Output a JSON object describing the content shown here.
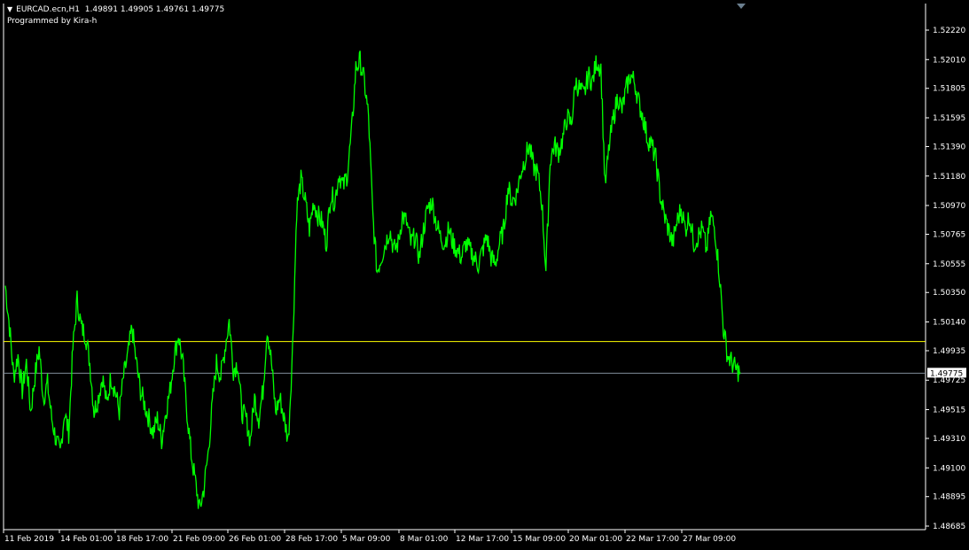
{
  "header": {
    "symbol": "EURCAD.ecn,H1",
    "ohlc": "1.49891 1.49905 1.49761 1.49775",
    "indicator": "Programmed by Kira-h"
  },
  "colors": {
    "background": "#000000",
    "axis": "#ffffff",
    "price_line": "#00ff00",
    "horizontal_line": "#ffff00",
    "bid_line": "#7f8c99",
    "bid_label_bg": "#ffffff",
    "bid_label_text": "#000000"
  },
  "chart_data": {
    "type": "line",
    "title": "",
    "xlabel": "",
    "ylabel": "",
    "ylim": [
      1.4858,
      1.5232
    ],
    "x_tick_labels": [
      "11 Feb 2019",
      "14 Feb 01:00",
      "18 Feb 17:00",
      "21 Feb 09:00",
      "26 Feb 01:00",
      "28 Feb 17:00",
      "5 Mar 09:00",
      "8 Mar 01:00",
      "12 Mar 17:00",
      "15 Mar 09:00",
      "20 Mar 01:00",
      "22 Mar 17:00",
      "27 Mar 09:00"
    ],
    "y_ticks": [
      "1.52220",
      "1.52010",
      "1.51805",
      "1.51595",
      "1.51390",
      "1.51180",
      "1.50970",
      "1.50765",
      "1.50555",
      "1.50350",
      "1.50140",
      "1.49935",
      "1.49725",
      "1.49515",
      "1.49310",
      "1.49100",
      "1.48895",
      "1.48685"
    ],
    "horizontal_level": 1.5,
    "current_price": "1.49775",
    "series": [
      {
        "values": [
          1.504,
          1.501,
          1.4975,
          1.499,
          1.4965,
          1.4985,
          1.495,
          1.4975,
          1.4995,
          1.496,
          1.497,
          1.4945,
          1.493,
          1.492,
          1.495,
          1.4935,
          1.4995,
          1.503,
          1.501,
          1.5005,
          1.4985,
          1.495,
          1.496,
          1.4975,
          1.4955,
          1.4975,
          1.4965,
          1.495,
          1.4975,
          1.499,
          1.501,
          1.4985,
          1.4965,
          1.4955,
          1.4945,
          1.4935,
          1.4945,
          1.493,
          1.495,
          1.4965,
          1.499,
          1.5005,
          1.4985,
          1.495,
          1.492,
          1.49,
          1.488,
          1.4895,
          1.492,
          1.4955,
          1.4985,
          1.4975,
          1.4995,
          1.5015,
          1.498,
          1.4985,
          1.495,
          1.4945,
          1.493,
          1.496,
          1.4945,
          1.4965,
          1.501,
          1.4985,
          1.495,
          1.496,
          1.4945,
          1.493,
          1.4995,
          1.5095,
          1.5115,
          1.51,
          1.508,
          1.51,
          1.509,
          1.5085,
          1.507,
          1.5105,
          1.51,
          1.512,
          1.511,
          1.512,
          1.515,
          1.5195,
          1.52,
          1.5185,
          1.516,
          1.509,
          1.505,
          1.506,
          1.507,
          1.508,
          1.5065,
          1.507,
          1.509,
          1.5085,
          1.507,
          1.5075,
          1.506,
          1.508,
          1.5095,
          1.51,
          1.5085,
          1.5075,
          1.507,
          1.508,
          1.507,
          1.5065,
          1.506,
          1.507,
          1.5065,
          1.506,
          1.5055,
          1.5065,
          1.5075,
          1.506,
          1.5055,
          1.507,
          1.508,
          1.511,
          1.51,
          1.5105,
          1.512,
          1.513,
          1.514,
          1.5125,
          1.512,
          1.51,
          1.505,
          1.513,
          1.514,
          1.5135,
          1.5145,
          1.516,
          1.5155,
          1.5185,
          1.518,
          1.5175,
          1.519,
          1.5185,
          1.52,
          1.5195,
          1.511,
          1.514,
          1.516,
          1.5175,
          1.5165,
          1.518,
          1.519,
          1.5185,
          1.517,
          1.516,
          1.5145,
          1.514,
          1.513,
          1.5105,
          1.509,
          1.508,
          1.507,
          1.5085,
          1.5095,
          1.508,
          1.509,
          1.507,
          1.5075,
          1.508,
          1.5065,
          1.509,
          1.508,
          1.505,
          1.501,
          1.499,
          1.4985,
          1.498,
          1.4978
        ]
      }
    ]
  }
}
